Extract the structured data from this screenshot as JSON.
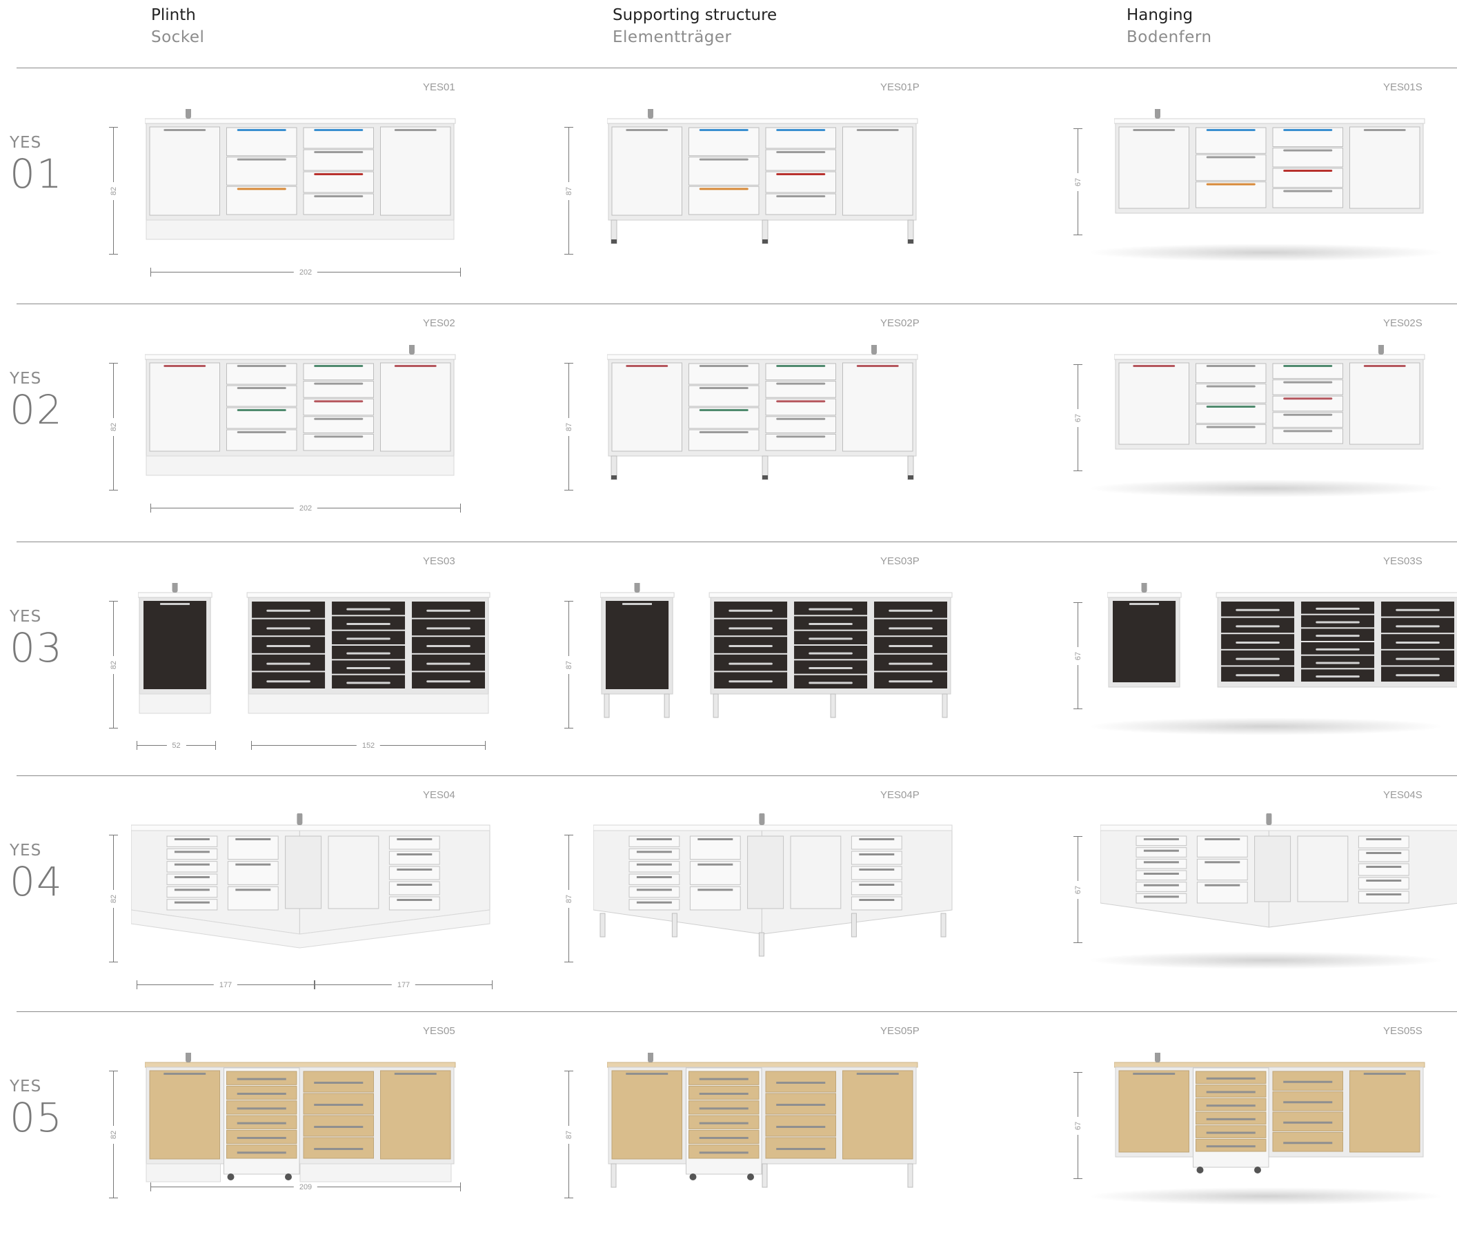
{
  "columns": [
    {
      "en": "Plinth",
      "de": "Sockel"
    },
    {
      "en": "Supporting structure",
      "de": "Elementträger"
    },
    {
      "en": "Hanging",
      "de": "Bodenfern"
    }
  ],
  "rows": [
    {
      "prefix": "YES",
      "number": "01",
      "codes": [
        "YES01",
        "YES01P",
        "YES01S"
      ],
      "heights": [
        "82",
        "87",
        "67"
      ],
      "widths": [
        "202"
      ]
    },
    {
      "prefix": "YES",
      "number": "02",
      "codes": [
        "YES02",
        "YES02P",
        "YES02S"
      ],
      "heights": [
        "82",
        "87",
        "67"
      ],
      "widths": [
        "202"
      ]
    },
    {
      "prefix": "YES",
      "number": "03",
      "codes": [
        "YES03",
        "YES03P",
        "YES03S"
      ],
      "heights": [
        "82",
        "87",
        "67"
      ],
      "widths": [
        "52",
        "152"
      ]
    },
    {
      "prefix": "YES",
      "number": "04",
      "codes": [
        "YES04",
        "YES04P",
        "YES04S"
      ],
      "heights": [
        "82",
        "87",
        "67"
      ],
      "widths": [
        "177",
        "177"
      ]
    },
    {
      "prefix": "YES",
      "number": "05",
      "codes": [
        "YES05",
        "YES05P",
        "YES05S"
      ],
      "heights": [
        "82",
        "87",
        "67"
      ],
      "widths": [
        "209"
      ]
    }
  ],
  "colors": {
    "cabinet_white": "#f3f3f3",
    "cabinet_dark": "#2f2a28",
    "cabinet_wood": "#d9bd8c",
    "handle_blue": "#3a8fd0",
    "handle_orange": "#d88a3a",
    "handle_red": "#b8322e",
    "handle_pink": "#b5565d",
    "handle_green": "#4f8a6e"
  }
}
